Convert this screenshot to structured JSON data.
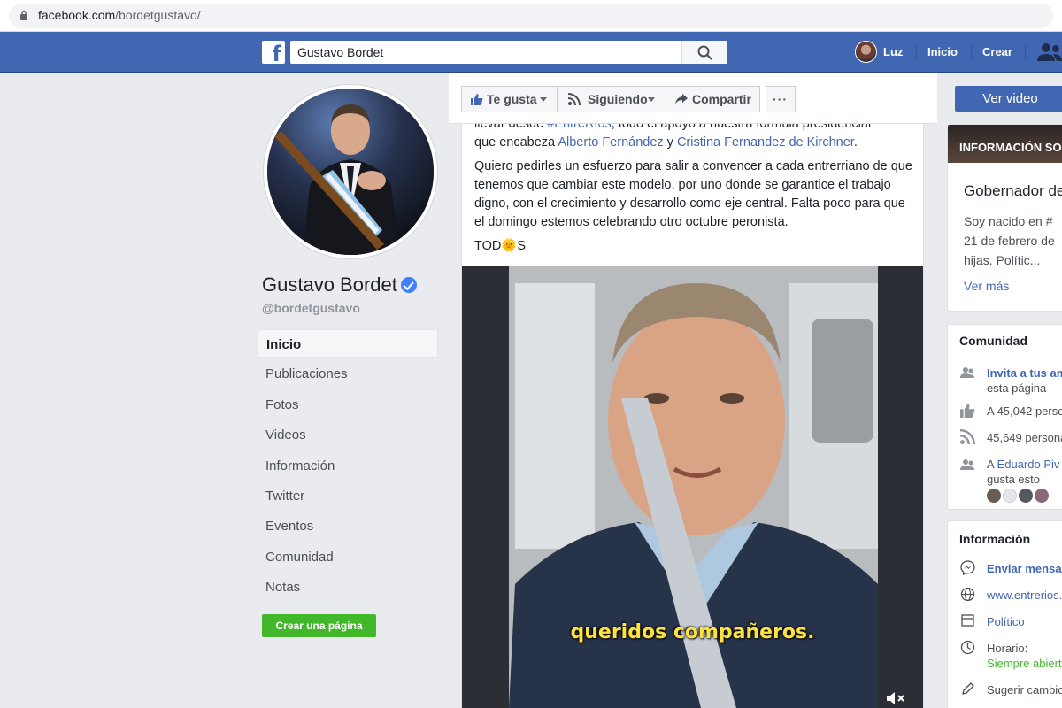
{
  "browser": {
    "url_host": "facebook.com",
    "url_path": "/bordetgustavo/"
  },
  "header": {
    "logo": "f",
    "search_value": "Gustavo Bordet",
    "user_name": "Luz",
    "nav": [
      "Inicio",
      "Crear"
    ],
    "brand_color": "#4267b2"
  },
  "profile": {
    "name": "Gustavo Bordet",
    "handle": "@bordetgustavo",
    "verified": true
  },
  "left_nav": {
    "items": [
      "Inicio",
      "Publicaciones",
      "Fotos",
      "Videos",
      "Información",
      "Twitter",
      "Eventos",
      "Comunidad",
      "Notas"
    ],
    "active": "Inicio",
    "create_page_label": "Crear una página"
  },
  "actions": {
    "like_label": "Te gusta",
    "follow_label": "Siguiendo",
    "share_label": "Compartir",
    "more_label": "···",
    "watch_video_label": "Ver video"
  },
  "post": {
    "line1_before": "llevar desde ",
    "line1_hashtag": "#EntreRíos",
    "line1_after": ", todo el apoyo a nuestra fórmula presidencial",
    "line2_before": "que encabeza ",
    "line2_link1": "Alberto Fernández",
    "line2_mid": " y ",
    "line2_link2": "Cristina Fernandez de Kirchner",
    "line2_after": ".",
    "paragraph2": "Quiero pedirles un esfuerzo para salir a convencer a cada entrerriano de que tenemos que cambiar este modelo, por uno donde se garantice el trabajo digno, con el crecimiento y desarrollo como eje central. Falta poco para que el domingo estemos celebrando otro octubre peronista.",
    "sign_before": "TOD",
    "sign_emoji": "🌞",
    "sign_after": "S",
    "video_caption": "queridos compañeros."
  },
  "about": {
    "banner": "INFORMACIÓN SOBRE",
    "title": "Gobernador de",
    "bio_lines": [
      "Soy nacido en #",
      "21 de febrero de",
      "hijas. Polític..."
    ],
    "see_more": "Ver más"
  },
  "community": {
    "title": "Comunidad",
    "invite_link": "Invita a tus am",
    "invite_rest": "esta página",
    "likes": "A 45,042 perso",
    "follows": "45,649 persona",
    "friend_prefix": "A ",
    "friend_name": "Eduardo Piv",
    "friend_rest": "gusta esto"
  },
  "information": {
    "title": "Información",
    "message": "Enviar mensa",
    "website": "www.entrerios.",
    "category": "Político",
    "hours_label": "Horario:",
    "hours_value": "Siempre abiert",
    "suggest": "Sugerir cambio"
  }
}
